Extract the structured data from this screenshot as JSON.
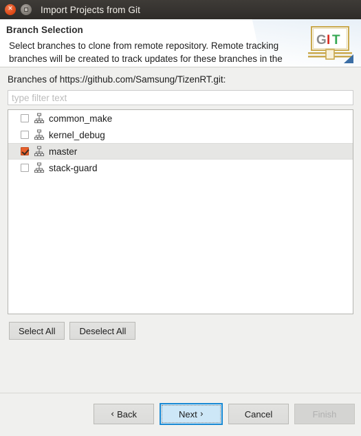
{
  "window": {
    "title": "Import Projects from Git",
    "close_icon": "close-icon",
    "maximize_icon": "maximize-icon"
  },
  "header": {
    "title": "Branch Selection",
    "description": "Select branches to clone from remote repository. Remote tracking branches will be created to track updates for these branches in the",
    "logo": {
      "name": "git-logo-icon",
      "letters": [
        "G",
        "I",
        "T"
      ],
      "colors": {
        "g": "#8c8c8c",
        "i": "#d93025",
        "t": "#34a853",
        "frame": "#c9a84c",
        "arrow": "#3b6ea5"
      }
    }
  },
  "main": {
    "branches_label": "Branches of https://github.com/Samsung/TizenRT.git:",
    "filter": {
      "placeholder": "type filter text",
      "value": ""
    },
    "branches": [
      {
        "name": "common_make",
        "checked": false,
        "selected": false,
        "icon": "git-branch-icon"
      },
      {
        "name": "kernel_debug",
        "checked": false,
        "selected": false,
        "icon": "git-branch-icon"
      },
      {
        "name": "master",
        "checked": true,
        "selected": true,
        "icon": "git-branch-icon"
      },
      {
        "name": "stack-guard",
        "checked": false,
        "selected": false,
        "icon": "git-branch-icon"
      }
    ],
    "select_all_label": "Select All",
    "deselect_all_label": "Deselect All"
  },
  "footer": {
    "back_label": "Back",
    "back_chevron": "‹",
    "next_label": "Next",
    "next_chevron": "›",
    "cancel_label": "Cancel",
    "finish_label": "Finish"
  },
  "colors": {
    "accent_blue": "#1a8ad4",
    "checkbox_orange": "#e8602c",
    "titlebar": "#35322f",
    "body_bg": "#f0f0ee"
  }
}
